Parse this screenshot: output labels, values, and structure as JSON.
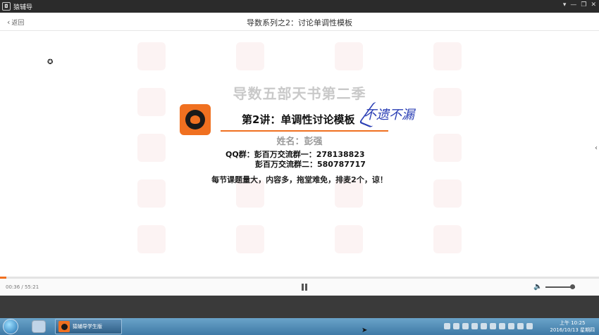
{
  "window": {
    "app_name": "猿辅导",
    "controls": [
      "▾",
      "—",
      "❐",
      "✕"
    ]
  },
  "header": {
    "back_label": "返回",
    "lecture_title": "导数系列之2：讨论单调性模板"
  },
  "slide": {
    "title": "导数五部天书第二季",
    "lesson": "第2讲：单调性讨论模板",
    "handwritten": "不遗不漏",
    "teacher": "姓名：彭强",
    "qq_line1": "QQ群：彭百万交流群一：278138823",
    "qq_line2": "彭百万交流群二：580787717",
    "notice": "每节课题量大，内容多，拖堂难免，排麦2个，谅！",
    "accent_color": "#f07020"
  },
  "player": {
    "time": "00:36 / 55:21",
    "progress_fraction": 0.011,
    "volume_fraction": 0.9
  },
  "taskbar": {
    "app_label": "猿辅导学生版",
    "clock_time": "上午 10:25",
    "clock_date": "2016/10/13 星期四"
  }
}
